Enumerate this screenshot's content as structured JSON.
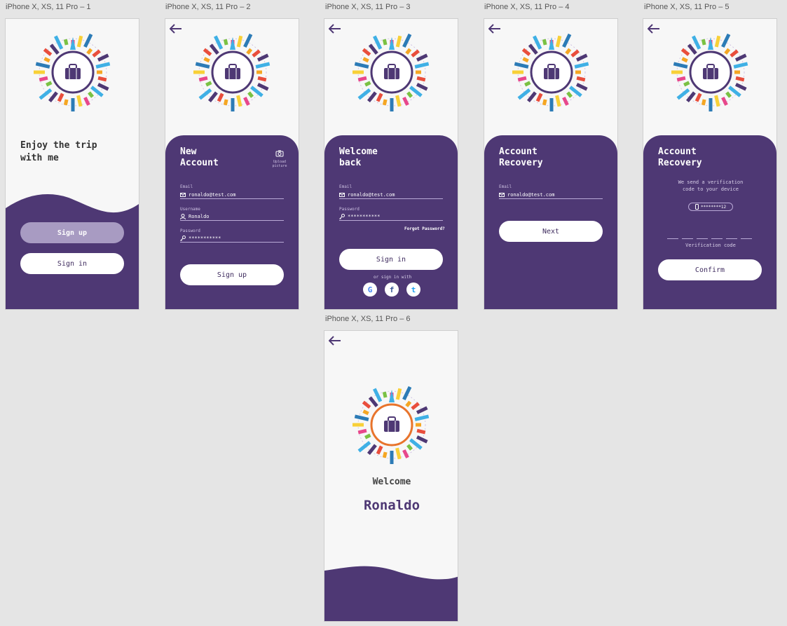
{
  "colors": {
    "purple": "#4e3874",
    "light_purple": "#a89bc2",
    "background": "#e5e5e5",
    "screen": "#f7f7f7"
  },
  "artboards": {
    "a1": {
      "label": "iPhone X, XS, 11 Pro – 1",
      "hero": "Enjoy the trip\nwith me",
      "signup": "Sign up",
      "signin": "Sign in"
    },
    "a2": {
      "label": "iPhone X, XS, 11 Pro – 2",
      "title": "New\nAccount",
      "upload": "Upload\npicture",
      "email_label": "Email",
      "email_value": "ronaldo@test.com",
      "username_label": "Username",
      "username_value": "Ronaldo",
      "password_label": "Password",
      "password_value": "***********",
      "button": "Sign up"
    },
    "a3": {
      "label": "iPhone X, XS, 11 Pro – 3",
      "title": "Welcome\nback",
      "email_label": "Email",
      "email_value": "ronaldo@test.com",
      "password_label": "Password",
      "password_value": "***********",
      "forgot": "Forgot Password?",
      "button": "Sign in",
      "or_sign_in": "or sign in with",
      "social": [
        "G",
        "f",
        "t"
      ]
    },
    "a4": {
      "label": "iPhone X, XS, 11 Pro – 4",
      "title": "Account\nRecovery",
      "email_label": "Email",
      "email_value": "ronaldo@test.com",
      "button": "Next"
    },
    "a5": {
      "label": "iPhone X, XS, 11 Pro – 5",
      "title": "Account\nRecovery",
      "message": "We send a verification\ncode to your device",
      "phone_masked": "********12",
      "code_label": "Verification code",
      "button": "Confirm"
    },
    "a6": {
      "label": "iPhone X, XS, 11 Pro – 6",
      "welcome": "Welcome",
      "name": "Ronaldo"
    }
  },
  "icons": [
    "back-arrow-icon",
    "suitcase-icon",
    "camera-icon",
    "mail-icon",
    "user-icon",
    "key-icon",
    "phone-icon",
    "google-icon",
    "facebook-icon",
    "twitter-icon"
  ]
}
